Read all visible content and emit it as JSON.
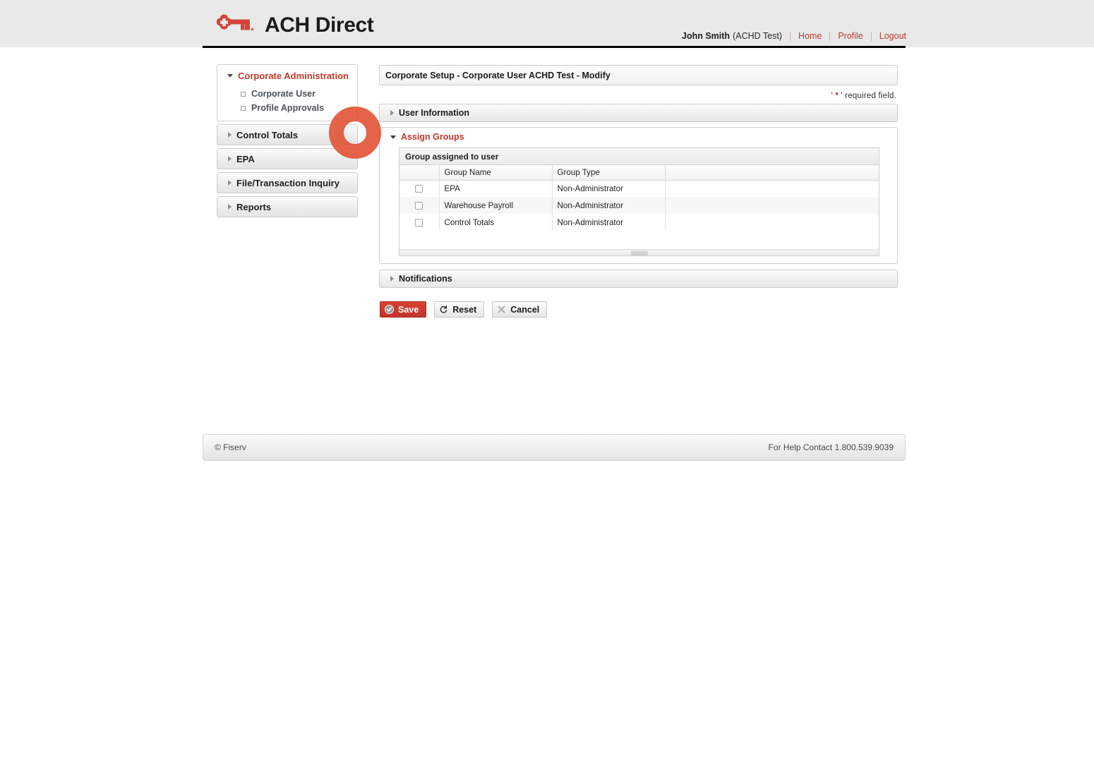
{
  "brand": {
    "name": "ACH Direct",
    "logo_icon": "key-icon",
    "logo_color": "#d4443a"
  },
  "header": {
    "user_name": "John Smith",
    "user_org": "(ACHD Test)",
    "links": [
      {
        "label": "Home",
        "name": "home-link"
      },
      {
        "label": "Profile",
        "name": "profile-link"
      },
      {
        "label": "Logout",
        "name": "logout-link"
      }
    ]
  },
  "sidebar": {
    "expanded_group": {
      "label": "Corporate Administration",
      "icon": "chevron-down-icon",
      "items": [
        {
          "label": "Corporate User",
          "icon": "small-square-icon"
        },
        {
          "label": "Profile Approvals",
          "icon": "small-square-icon"
        }
      ]
    },
    "collapsed_groups": [
      {
        "label": "Control Totals",
        "icon": "chevron-right-icon"
      },
      {
        "label": "EPA",
        "icon": "chevron-right-icon"
      },
      {
        "label": "File/Transaction Inquiry",
        "icon": "chevron-right-icon"
      },
      {
        "label": "Reports",
        "icon": "chevron-right-icon"
      }
    ]
  },
  "main": {
    "page_title": "Corporate Setup - Corporate User ACHD Test - Modify",
    "required_prefix": "' ",
    "required_star": "*",
    "required_suffix": " ' required field.",
    "sections": {
      "user_information": {
        "label": "User Information",
        "icon": "chevron-right-icon",
        "state": "collapsed"
      },
      "assign_groups": {
        "label": "Assign Groups",
        "icon": "chevron-down-icon",
        "state": "expanded",
        "grid_caption": "Group assigned to user",
        "columns": [
          "",
          "Group Name",
          "Group Type",
          ""
        ],
        "rows": [
          {
            "checked": false,
            "group_name": "EPA",
            "group_type": "Non-Administrator"
          },
          {
            "checked": false,
            "group_name": "Warehouse Payroll",
            "group_type": "Non-Administrator"
          },
          {
            "checked": false,
            "group_name": "Control Totals",
            "group_type": "Non-Administrator"
          }
        ]
      },
      "notifications": {
        "label": "Notifications",
        "icon": "chevron-right-icon",
        "state": "collapsed"
      }
    },
    "buttons": [
      {
        "label": "Save",
        "icon": "check-circle-icon",
        "style": "primary"
      },
      {
        "label": "Reset",
        "icon": "refresh-icon",
        "style": "default"
      },
      {
        "label": "Cancel",
        "icon": "x-icon",
        "style": "default"
      }
    ]
  },
  "footer": {
    "copyright": "© Fiserv",
    "help": "For Help Contact 1.800.539.9039"
  }
}
